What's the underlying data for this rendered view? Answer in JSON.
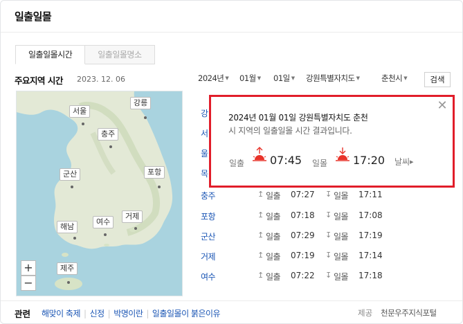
{
  "title": "일출일몰",
  "tabs": [
    {
      "label": "일출일몰시간",
      "active": true
    },
    {
      "label": "일출일몰명소",
      "active": false
    }
  ],
  "section": {
    "heading": "주요지역 시간",
    "date": "2023. 12. 06"
  },
  "filters": {
    "year": "2024년",
    "month": "01월",
    "day": "01일",
    "province": "강원특별자치도",
    "city": "춘천시",
    "search_label": "검색"
  },
  "map": {
    "cities": [
      "서울",
      "강릉",
      "충주",
      "군산",
      "포항",
      "해남",
      "여수",
      "거제",
      "제주"
    ],
    "zoom_in": "+",
    "zoom_out": "−"
  },
  "rows": [
    {
      "city": "강"
    },
    {
      "city": "서"
    },
    {
      "city": "울"
    },
    {
      "city": "목"
    },
    {
      "city": "충주",
      "rise_label": "일출",
      "rise": "07:27",
      "set_label": "일몰",
      "set": "17:11"
    },
    {
      "city": "포항",
      "rise_label": "일출",
      "rise": "07:18",
      "set_label": "일몰",
      "set": "17:08"
    },
    {
      "city": "군산",
      "rise_label": "일출",
      "rise": "07:29",
      "set_label": "일몰",
      "set": "17:19"
    },
    {
      "city": "거제",
      "rise_label": "일출",
      "rise": "07:19",
      "set_label": "일몰",
      "set": "17:14"
    },
    {
      "city": "여수",
      "rise_label": "일출",
      "rise": "07:22",
      "set_label": "일몰",
      "set": "17:18"
    }
  ],
  "popup": {
    "line1": "2024년 01월 01일 강원특별자치도 춘천",
    "line2": "시 지역의 일출일몰 시간 결과입니다.",
    "sunrise_label": "일출",
    "sunrise_time": "07:45",
    "sunset_label": "일몰",
    "sunset_time": "17:20",
    "weather_label": "날씨",
    "close_icon": "close-icon"
  },
  "related": {
    "title": "관련",
    "links": [
      "해맞이 축제",
      "신정",
      "박명이란",
      "일출일몰이 붉은이유"
    ]
  },
  "provider": {
    "label": "제공",
    "name": "천문우주지식포털"
  },
  "colors": {
    "accent_red": "#e11d2a",
    "link_blue": "#1a55b4",
    "sun_red": "#e8332a"
  }
}
